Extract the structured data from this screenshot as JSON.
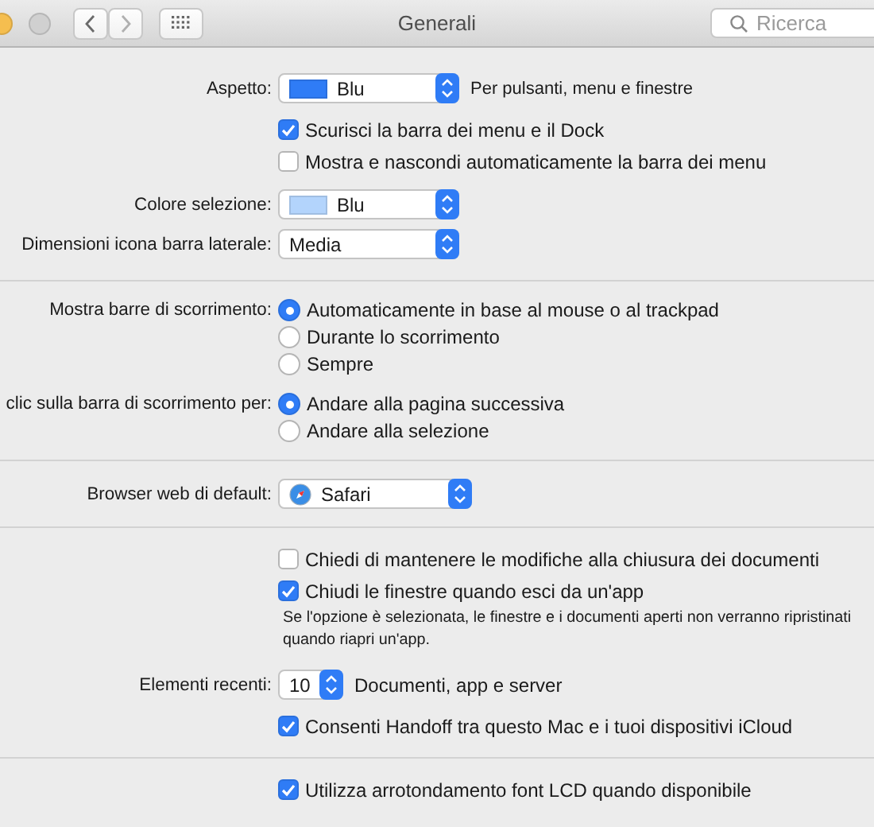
{
  "window": {
    "title": "Generali"
  },
  "toolbar": {
    "search": {
      "placeholder": "Ricerca"
    }
  },
  "sections": [
    {
      "rows": [
        {
          "kind": "color-popup",
          "label": "Aspetto:",
          "value": "Blu",
          "color": "#2f7cf6",
          "note": "Per pulsanti, menu e finestre"
        },
        {
          "kind": "checkbox",
          "text": "Scurisci la barra dei menu e il Dock",
          "checked": true
        },
        {
          "kind": "checkbox",
          "text": "Mostra e nascondi automaticamente la barra dei menu",
          "checked": false
        },
        {
          "kind": "color-popup",
          "label": "Colore selezione:",
          "value": "Blu",
          "color": "#b3d4fc"
        },
        {
          "kind": "popup",
          "label": "Dimensioni icona barra laterale:",
          "value": "Media"
        }
      ]
    },
    {
      "rows": [
        {
          "kind": "radio",
          "label": "Mostra barre di scorrimento:",
          "options": [
            {
              "text": "Automaticamente in base al mouse o al trackpad",
              "selected": true
            },
            {
              "text": "Durante lo scorrimento",
              "selected": false
            },
            {
              "text": "Sempre",
              "selected": false
            }
          ]
        },
        {
          "kind": "radio",
          "label": "clic sulla barra di scorrimento per:",
          "options": [
            {
              "text": "Andare alla pagina successiva",
              "selected": true
            },
            {
              "text": "Andare alla selezione",
              "selected": false
            }
          ]
        }
      ]
    },
    {
      "rows": [
        {
          "kind": "app-popup",
          "label": "Browser web di default:",
          "value": "Safari"
        }
      ]
    },
    {
      "rows": [
        {
          "kind": "checkbox",
          "text": "Chiedi di mantenere le modifiche alla chiusura dei documenti",
          "checked": false
        },
        {
          "kind": "checkbox",
          "text": "Chiudi le finestre quando esci da un'app",
          "checked": true
        },
        {
          "kind": "note",
          "lines": [
            "Se l'opzione è selezionata, le finestre e i documenti aperti non verranno ripristinati",
            "quando riapri un'app."
          ]
        },
        {
          "kind": "number-popup",
          "label": "Elementi recenti:",
          "value": "10",
          "note": "Documenti, app e server"
        },
        {
          "kind": "checkbox",
          "text": "Consenti Handoff tra questo Mac e i tuoi dispositivi iCloud",
          "checked": true
        }
      ]
    },
    {
      "rows": [
        {
          "kind": "checkbox",
          "text": "Utilizza arrotondamento font LCD quando disponibile",
          "checked": true
        }
      ]
    }
  ]
}
